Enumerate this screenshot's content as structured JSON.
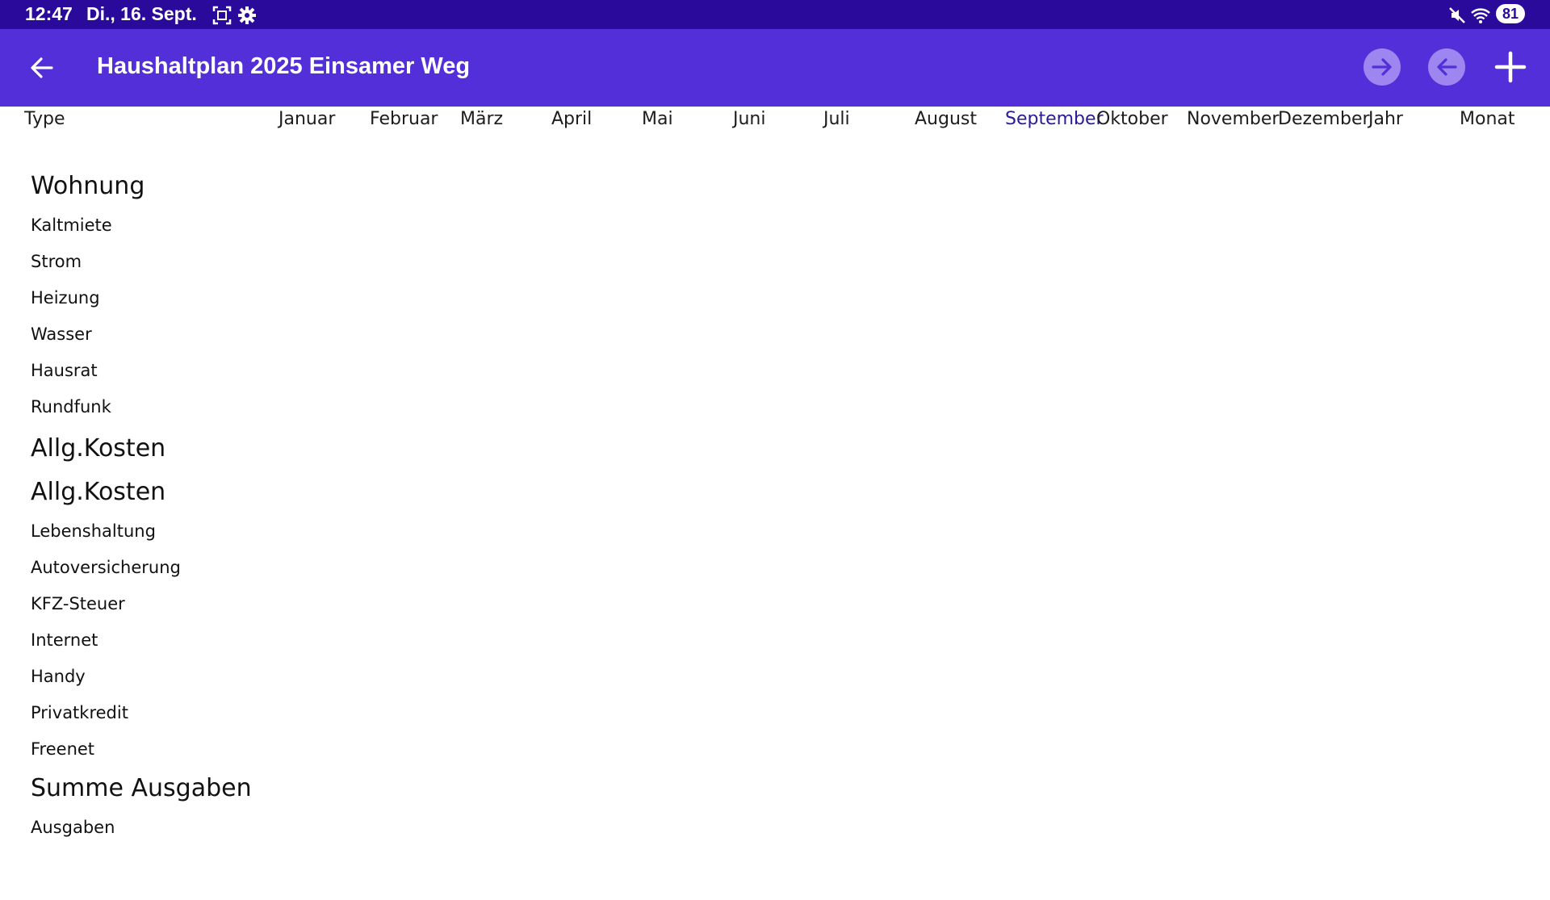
{
  "status_bar": {
    "time": "12:47",
    "date": "Di., 16. Sept.",
    "battery": "81",
    "icons": [
      "screenshot-icon",
      "gear-icon",
      "mute-icon",
      "wifi-icon"
    ]
  },
  "app_bar": {
    "title": "Haushaltplan 2025 Einsamer Weg",
    "back_icon": "arrow-left-icon",
    "next_icon": "arrow-right-circle-icon",
    "prev_icon": "arrow-left-circle-icon",
    "add_icon": "plus-icon",
    "colors": {
      "status": "#2a0a9a",
      "bar": "#532fd9",
      "circle": "#9d86ef",
      "current_month": "#2a1a9a"
    }
  },
  "columns": {
    "type": "Type",
    "months": [
      "Januar",
      "Februar",
      "März",
      "April",
      "Mai",
      "Juni",
      "Juli",
      "August",
      "September",
      "Oktober",
      "November",
      "Dezember"
    ],
    "year": "Jahr",
    "month": "Monat",
    "current_month": "September"
  },
  "groups": [
    {
      "title": "Wohnung",
      "items": [
        "Kaltmiete",
        "Strom",
        "Heizung",
        "Wasser",
        "Hausrat",
        "Rundfunk"
      ]
    },
    {
      "title": "Allg.Kosten",
      "items": []
    },
    {
      "title": "Allg.Kosten",
      "items": [
        "Lebenshaltung",
        "Autoversicherung",
        "KFZ-Steuer",
        "Internet",
        "Handy",
        "Privatkredit",
        "Freenet"
      ]
    },
    {
      "title": "Summe Ausgaben",
      "items": [
        "Ausgaben"
      ]
    }
  ]
}
